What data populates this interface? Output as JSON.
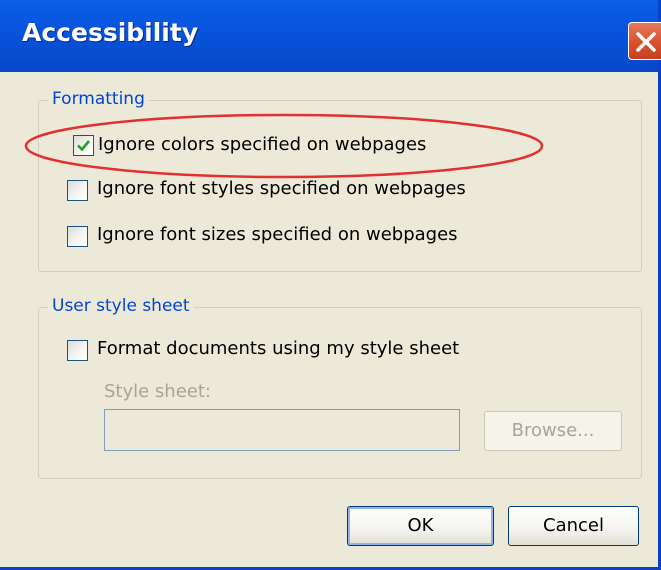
{
  "window": {
    "title": "Accessibility",
    "close_icon": "close-icon"
  },
  "formatting": {
    "legend": "Formatting",
    "options": [
      {
        "label": "Ignore colors specified on webpages",
        "checked": true,
        "highlighted": true
      },
      {
        "label": "Ignore font styles specified on webpages",
        "checked": false
      },
      {
        "label": "Ignore font sizes specified on webpages",
        "checked": false
      }
    ]
  },
  "user_style_sheet": {
    "legend": "User style sheet",
    "format_option": {
      "label": "Format documents using my style sheet",
      "checked": false
    },
    "style_sheet_label": "Style sheet:",
    "style_sheet_value": "",
    "browse_label": "Browse..."
  },
  "buttons": {
    "ok": "OK",
    "cancel": "Cancel"
  },
  "colors": {
    "title_bar": "#0a56e0",
    "legend_text": "#0046d5",
    "annotation": "#e03030",
    "dialog_bg": "#ece9d8"
  }
}
